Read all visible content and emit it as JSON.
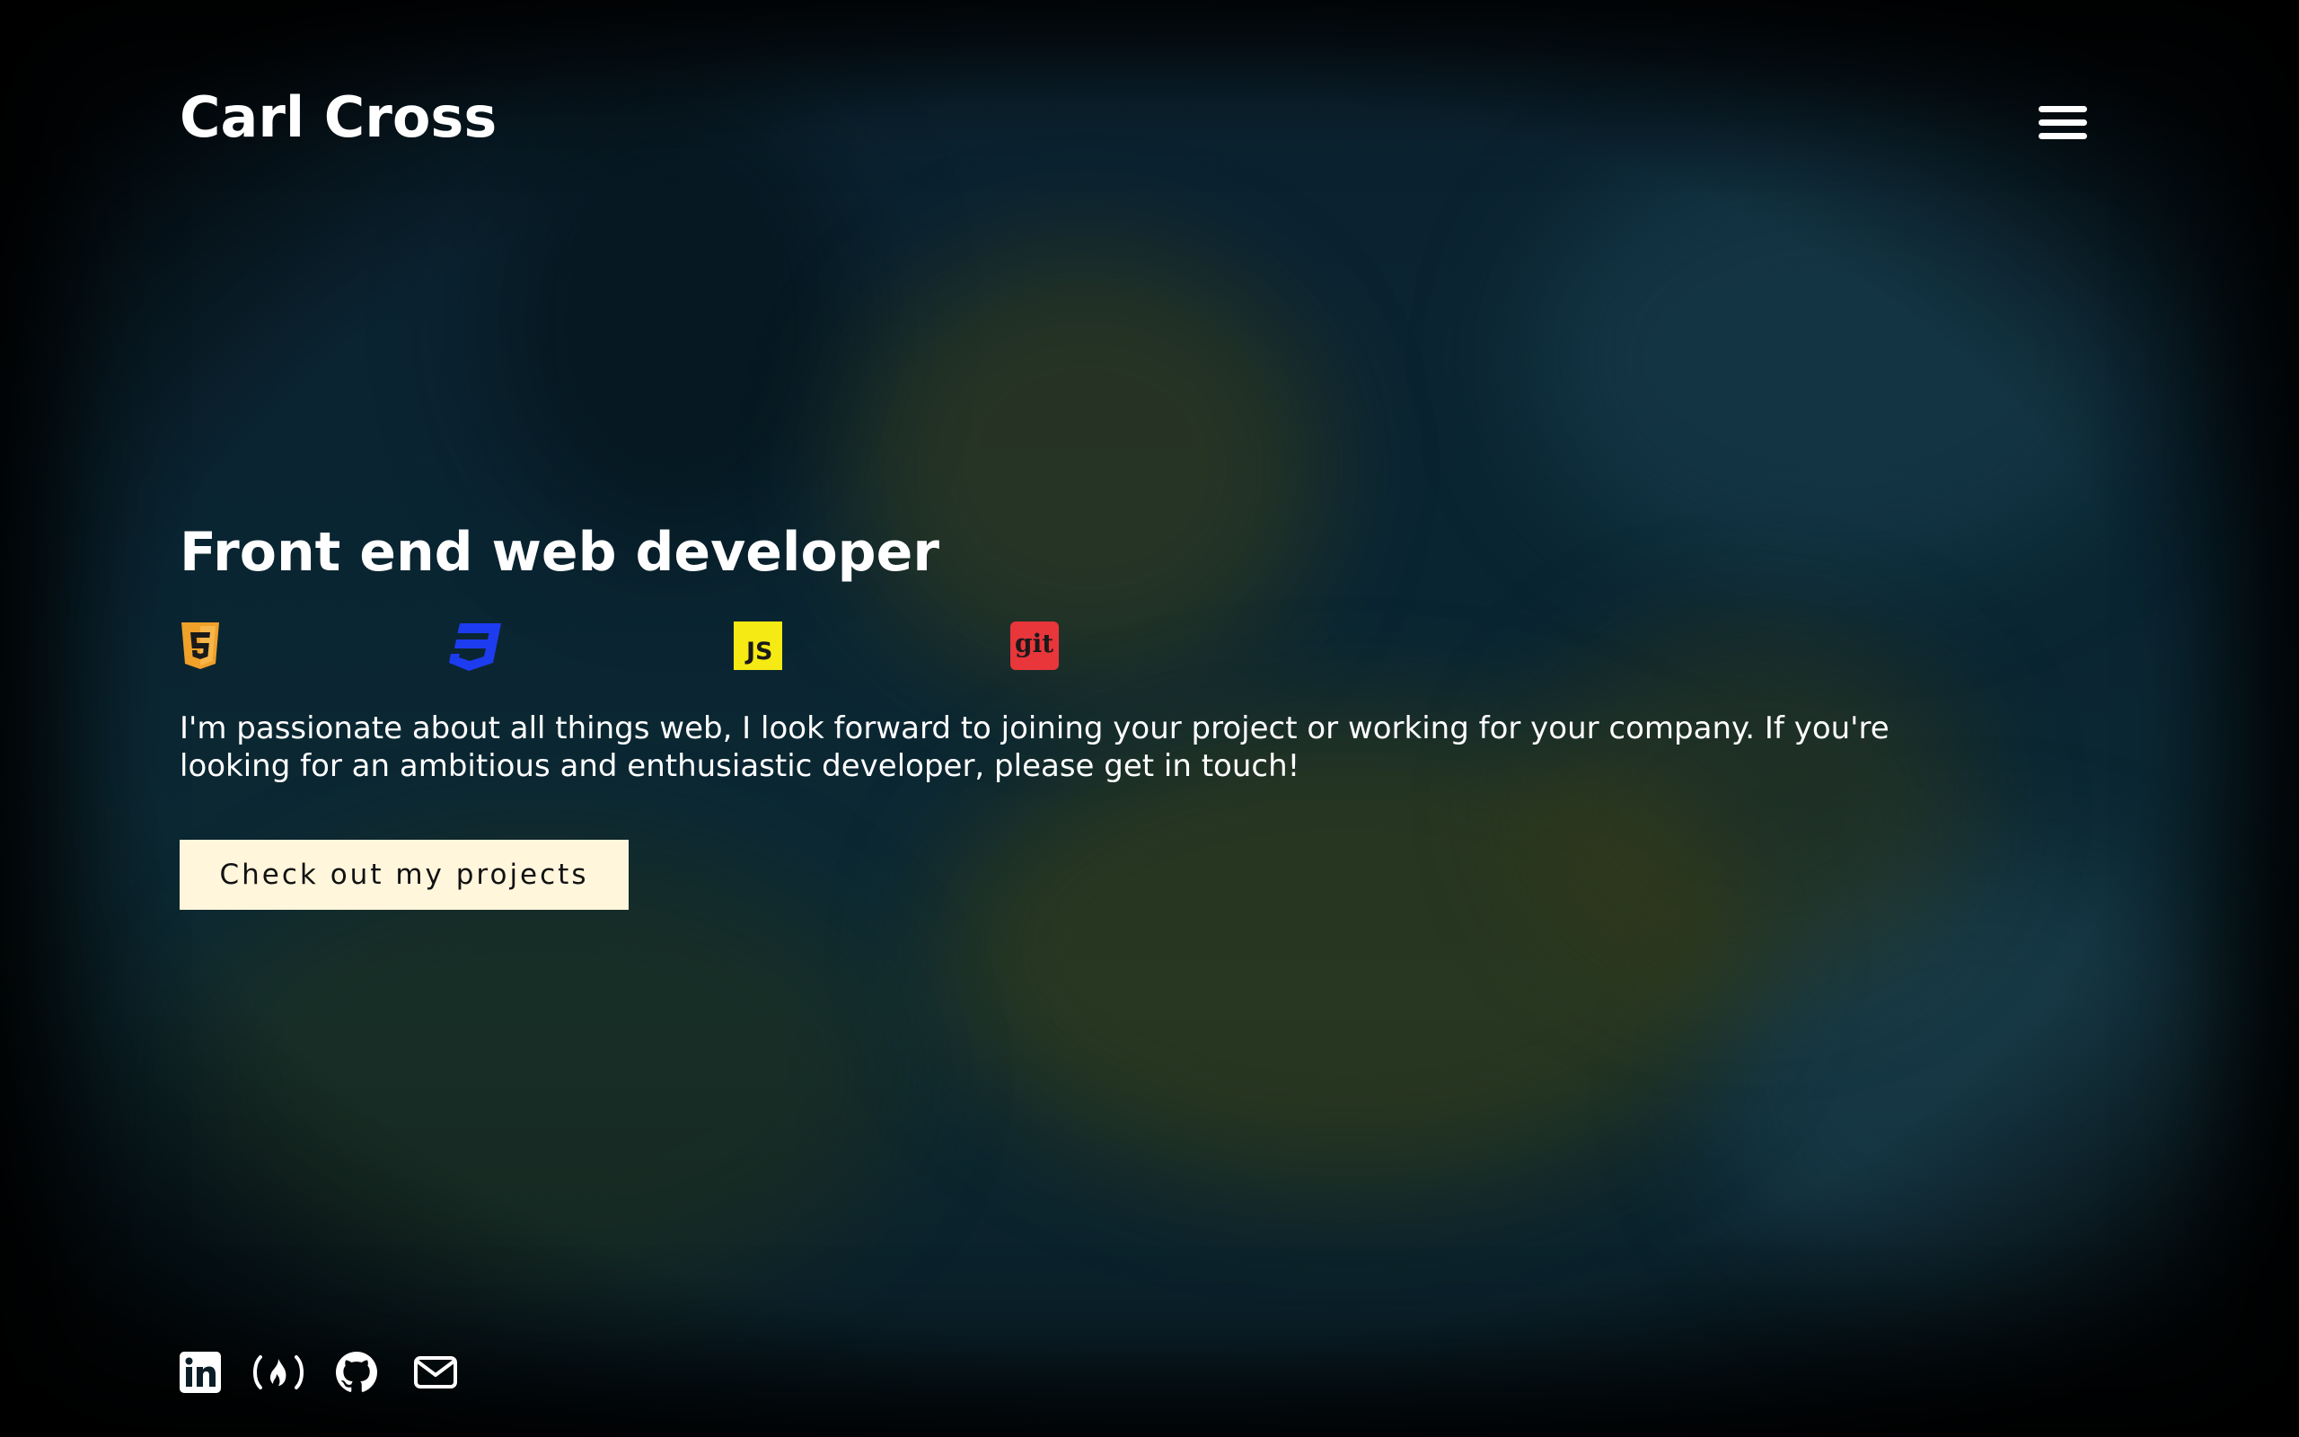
{
  "header": {
    "brand": "Carl Cross",
    "menu_icon": "hamburger-menu-icon"
  },
  "hero": {
    "title": "Front end web developer",
    "tech_icons": [
      {
        "name": "html5-icon",
        "color": "#f0a12a"
      },
      {
        "name": "css3-icon",
        "color": "#1d3cf0"
      },
      {
        "name": "javascript-icon",
        "label": "JS",
        "color": "#f5ea14"
      },
      {
        "name": "git-icon",
        "label": "git",
        "color": "#e8363b"
      }
    ],
    "intro": "I'm passionate about all things web, I look forward to joining your project or working for your company. If you're looking for an ambitious and enthusiastic developer, please get in touch!",
    "cta_label": "Check out my projects"
  },
  "socials": [
    {
      "name": "linkedin-icon"
    },
    {
      "name": "freecodecamp-icon"
    },
    {
      "name": "github-icon"
    },
    {
      "name": "mail-icon"
    }
  ],
  "colors": {
    "background": "#0a2532",
    "text": "#ffffff",
    "cta_background": "#fff6dc",
    "cta_text": "#111111"
  }
}
